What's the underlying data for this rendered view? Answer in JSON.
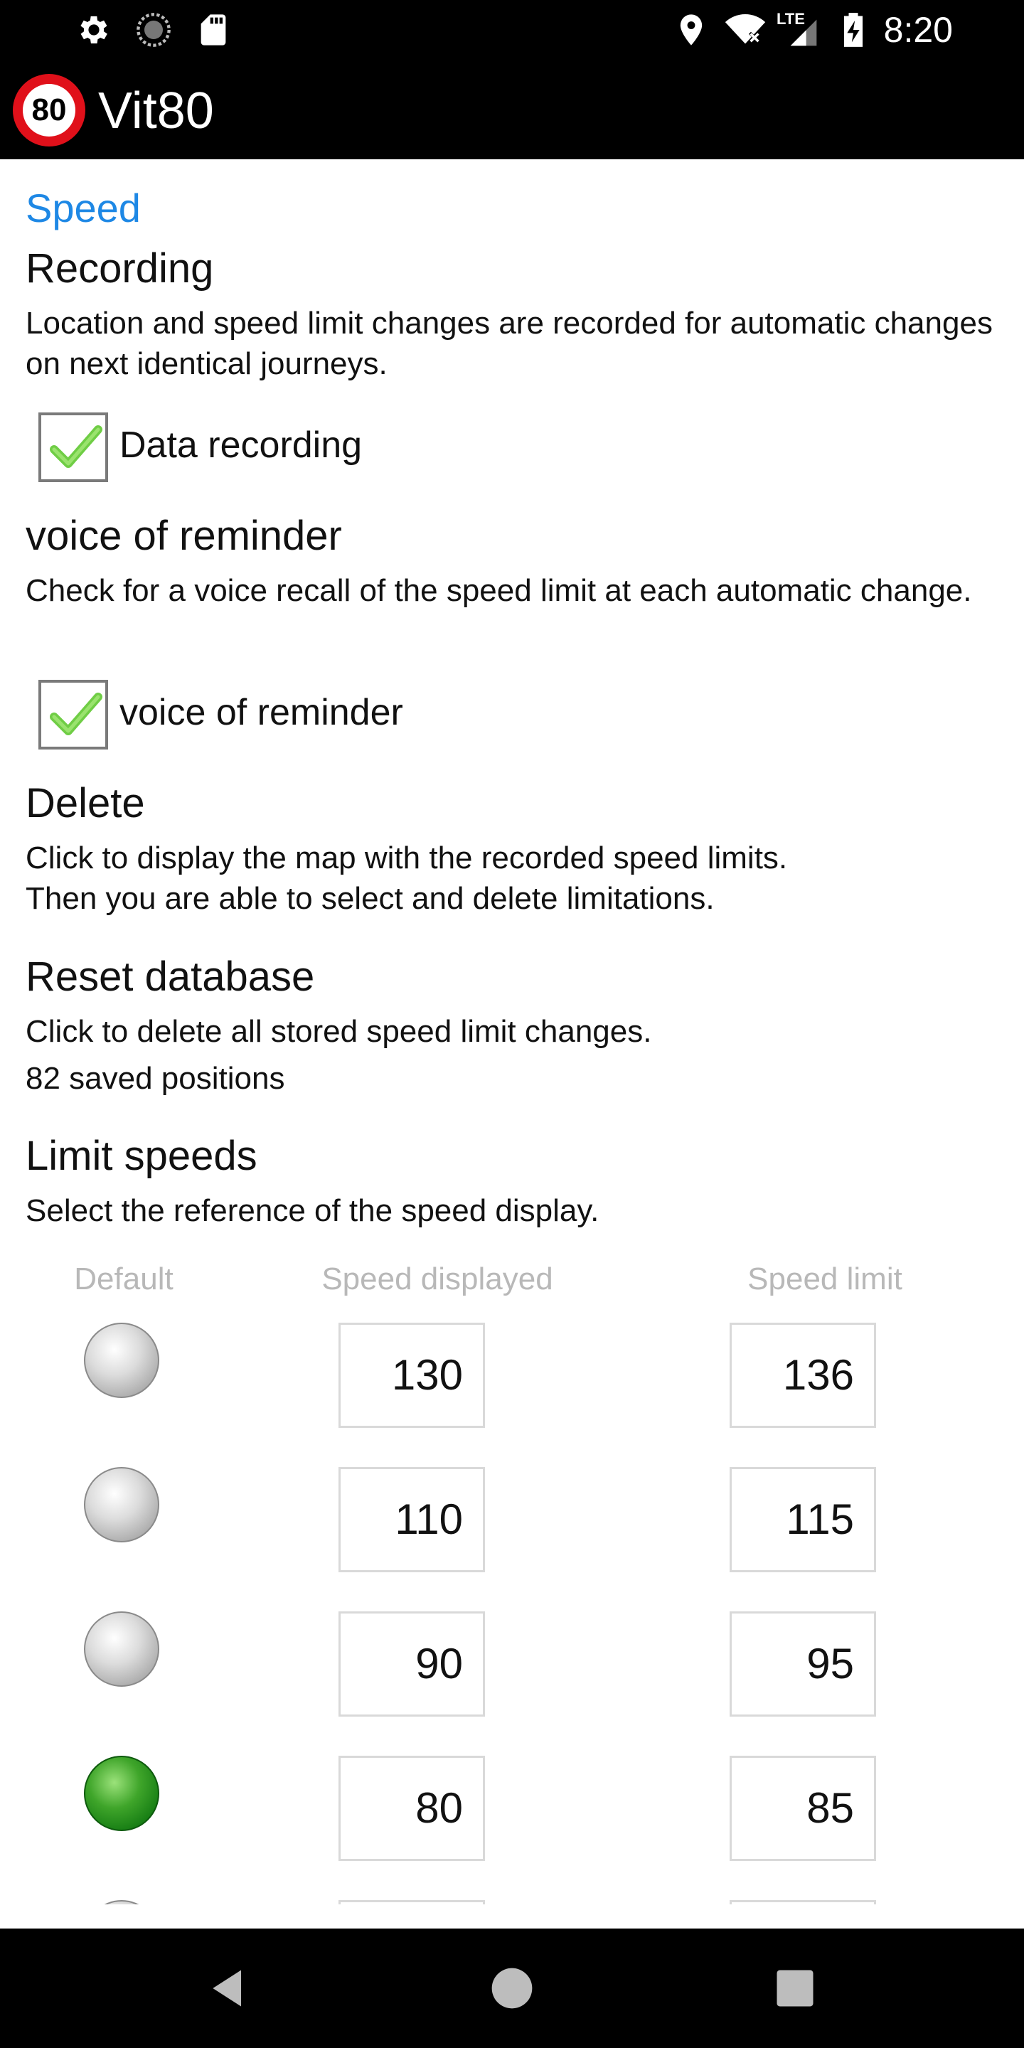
{
  "status_bar": {
    "time": "8:20",
    "network_label": "LTE",
    "icons": [
      "gear-icon",
      "loading-icon",
      "sd-card-icon",
      "location-icon",
      "wifi-icon",
      "signal-icon",
      "battery-charging-icon"
    ]
  },
  "app": {
    "title": "Vit80",
    "logo_text": "80",
    "logo_color": "#e0101a"
  },
  "settings": {
    "category": "Speed",
    "category_color": "#1e88e5",
    "recording": {
      "title": "Recording",
      "summary": "Location and speed limit changes are recorded for automatic changes on next identical journeys.",
      "checkbox_label": "Data recording",
      "checked": true
    },
    "voice": {
      "title": "voice of reminder",
      "summary": "Check for a voice recall of the speed limit at each automatic change.",
      "checkbox_label": "voice of reminder",
      "checked": true
    },
    "delete": {
      "title": "Delete",
      "summary_line1": "Click to display the map with the recorded speed limits.",
      "summary_line2": "Then you are able to select and delete limitations."
    },
    "reset": {
      "title": "Reset database",
      "summary": "Click to delete all stored speed limit changes.",
      "count": "82 saved positions"
    },
    "limits": {
      "title": "Limit speeds",
      "summary": "Select the reference of the speed display.",
      "headers": {
        "default": "Default",
        "displayed": "Speed displayed",
        "limit": "Speed limit"
      },
      "rows": [
        {
          "displayed": "130",
          "limit": "136",
          "selected": false
        },
        {
          "displayed": "110",
          "limit": "115",
          "selected": false
        },
        {
          "displayed": "90",
          "limit": "95",
          "selected": false
        },
        {
          "displayed": "80",
          "limit": "85",
          "selected": true
        }
      ]
    }
  },
  "nav": {
    "icons": [
      "back-icon",
      "home-icon",
      "recents-icon"
    ]
  }
}
